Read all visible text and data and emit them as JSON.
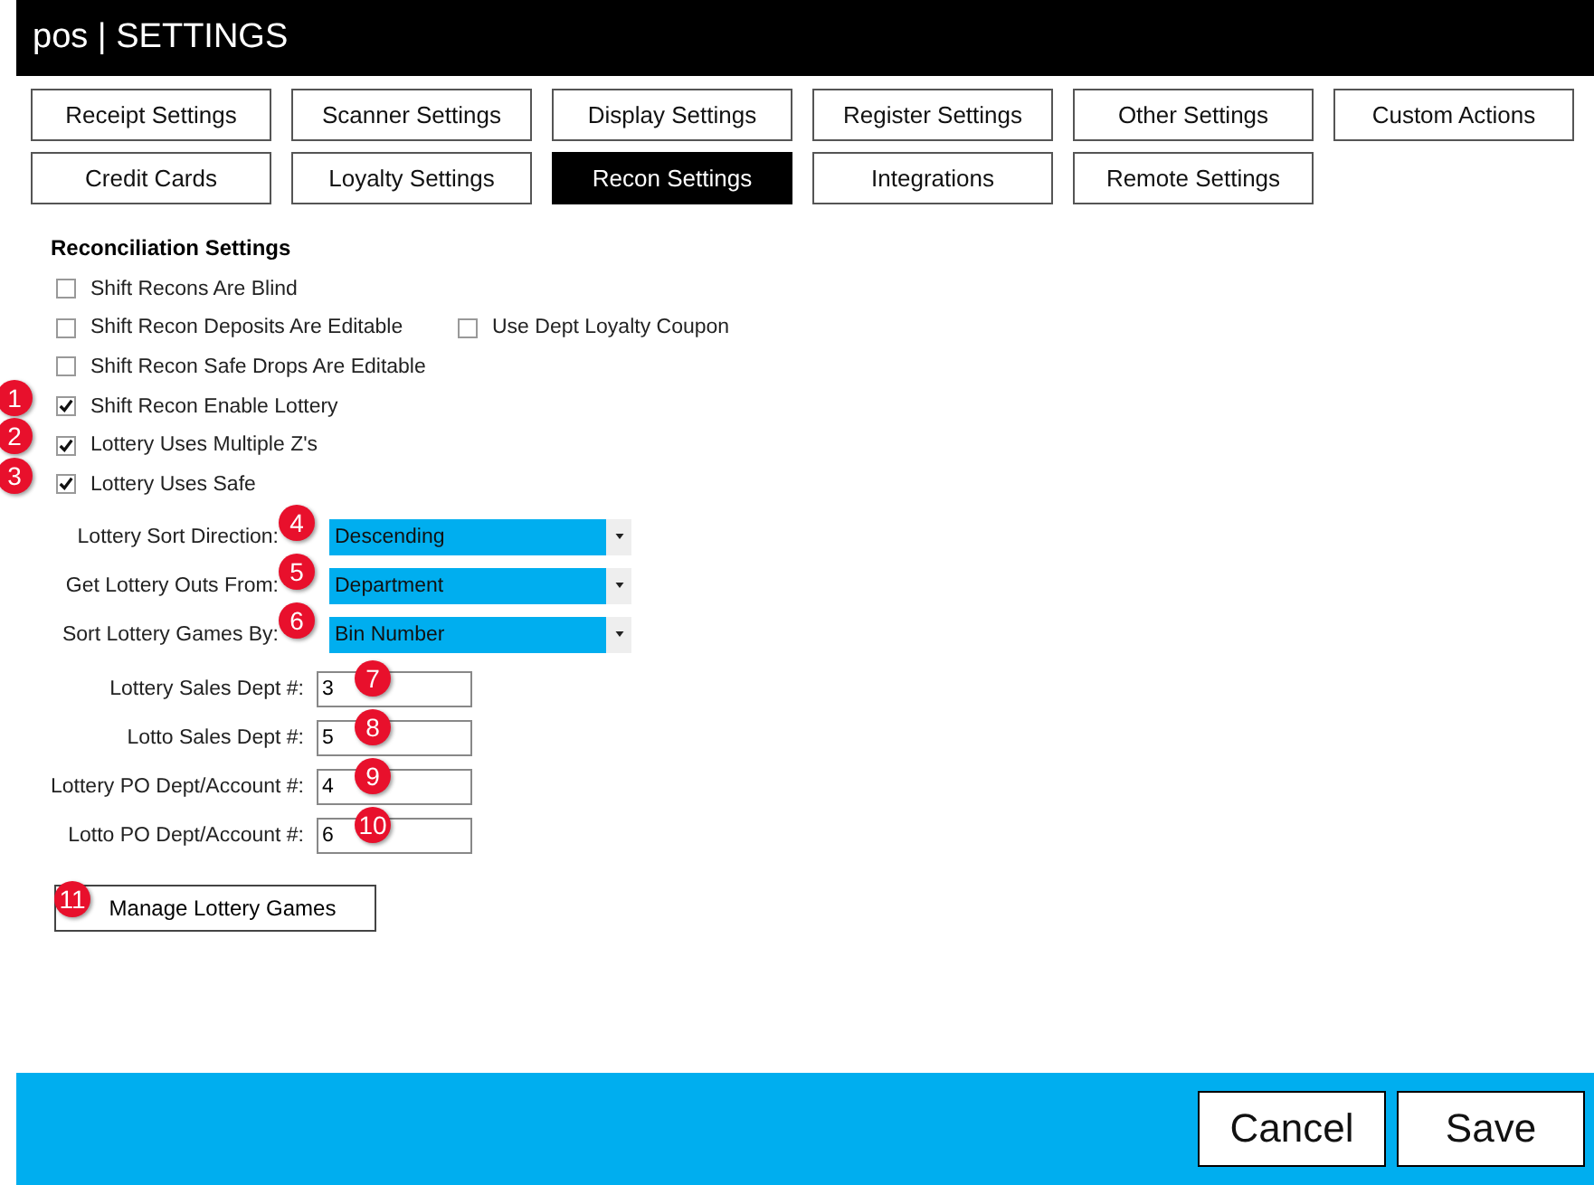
{
  "window": {
    "title": "pos | SETTINGS"
  },
  "tabs": [
    [
      {
        "label": "Receipt Settings",
        "selected": false
      },
      {
        "label": "Scanner Settings",
        "selected": false
      },
      {
        "label": "Display Settings",
        "selected": false
      },
      {
        "label": "Register Settings",
        "selected": false
      },
      {
        "label": "Other Settings",
        "selected": false
      },
      {
        "label": "Custom Actions",
        "selected": false
      }
    ],
    [
      {
        "label": "Credit Cards",
        "selected": false
      },
      {
        "label": "Loyalty Settings",
        "selected": false
      },
      {
        "label": "Recon Settings",
        "selected": true
      },
      {
        "label": "Integrations",
        "selected": false
      },
      {
        "label": "Remote Settings",
        "selected": false
      }
    ]
  ],
  "section_title": "Reconciliation Settings",
  "checkbox_rows": [
    [
      {
        "label": "Shift Recons Are Blind",
        "checked": false
      }
    ],
    [
      {
        "label": "Shift Recon Deposits Are Editable",
        "checked": false
      },
      {
        "label": "Use Dept Loyalty Coupon",
        "checked": false
      }
    ],
    [
      {
        "label": "Shift Recon Safe Drops Are Editable",
        "checked": false
      }
    ],
    [
      {
        "label": "Shift Recon Enable Lottery",
        "checked": true,
        "badge": "1"
      }
    ],
    [
      {
        "label": "Lottery Uses Multiple Z's",
        "checked": true,
        "badge": "2"
      }
    ],
    [
      {
        "label": "Lottery Uses Safe",
        "checked": true,
        "badge": "3"
      }
    ]
  ],
  "dropdowns": [
    {
      "label": "Lottery Sort Direction:",
      "value": "Descending",
      "badge": "4"
    },
    {
      "label": "Get Lottery Outs From:",
      "value": "Department",
      "badge": "5"
    },
    {
      "label": "Sort Lottery Games By:",
      "value": "Bin Number",
      "badge": "6"
    }
  ],
  "fields": [
    {
      "label": "Lottery Sales Dept #:",
      "value": "3",
      "badge": "7"
    },
    {
      "label": "Lotto Sales Dept #:",
      "value": "5",
      "badge": "8"
    },
    {
      "label": "Lottery PO Dept/Account #:",
      "value": "4",
      "badge": "9"
    },
    {
      "label": "Lotto PO Dept/Account #:",
      "value": "6",
      "badge": "10"
    }
  ],
  "manage_button": {
    "label": "Manage Lottery Games",
    "badge": "11"
  },
  "footer_buttons": [
    "Cancel",
    "Save"
  ]
}
